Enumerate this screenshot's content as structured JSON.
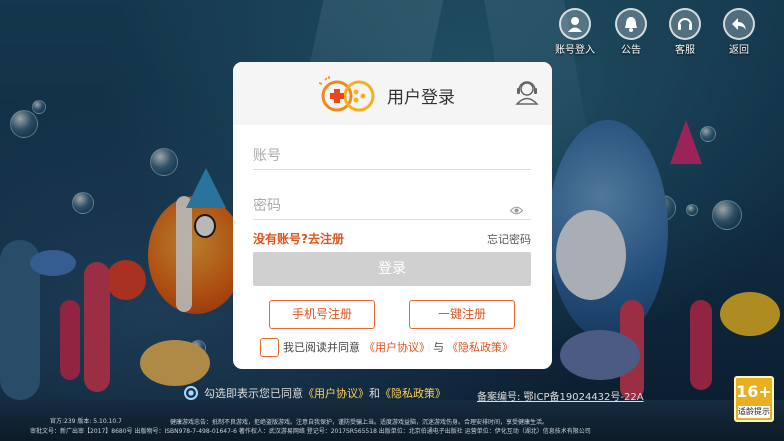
{
  "top_buttons": [
    {
      "label": "账号登入",
      "icon": "user-icon"
    },
    {
      "label": "公告",
      "icon": "bell-icon"
    },
    {
      "label": "客服",
      "icon": "headset-icon"
    },
    {
      "label": "返回",
      "icon": "back-arrow-icon"
    }
  ],
  "dialog": {
    "title": "用户登录",
    "account_placeholder": "账号",
    "password_placeholder": "密码",
    "register_link": "没有账号?去注册",
    "forgot_link": "忘记密码",
    "login_button": "登录",
    "phone_register": "手机号注册",
    "quick_register": "一键注册",
    "agree_prefix": "我已阅读并同意",
    "user_agreement": "《用户协议》",
    "and": "与",
    "privacy_policy": "《隐私政策》"
  },
  "bottom": {
    "notice_prefix": "勾选即表示您已同意",
    "user_agreement": "《用户协议》",
    "and": "和",
    "privacy_policy": "《隐私政策》",
    "record": "备案编号: 鄂ICP备19024432号-22A",
    "version": "官方:239 版本: 5.10.10.7",
    "approval": "审批文号：新广出审【2017】8680号 出版物号：ISBN978-7-498-01647-6 著作权人：武汉游易网络 登记号：2017SR565518 出版单位：北京伯通电子出版社 运营单位：伊化互动（湖北）信息技术有限公司",
    "health_notice": "健康游戏忠告：抵制不良游戏，拒绝盗版游戏。注意自我保护，谨防受骗上当。适度游戏益脑，沉迷游戏伤身。合理安排时间，享受健康生活。"
  },
  "age_rating": {
    "number": "16+",
    "text": "适龄提示"
  },
  "colors": {
    "accent": "#e2541e",
    "login_disabled": "#d0d0d0",
    "badge": "#e8b020"
  }
}
